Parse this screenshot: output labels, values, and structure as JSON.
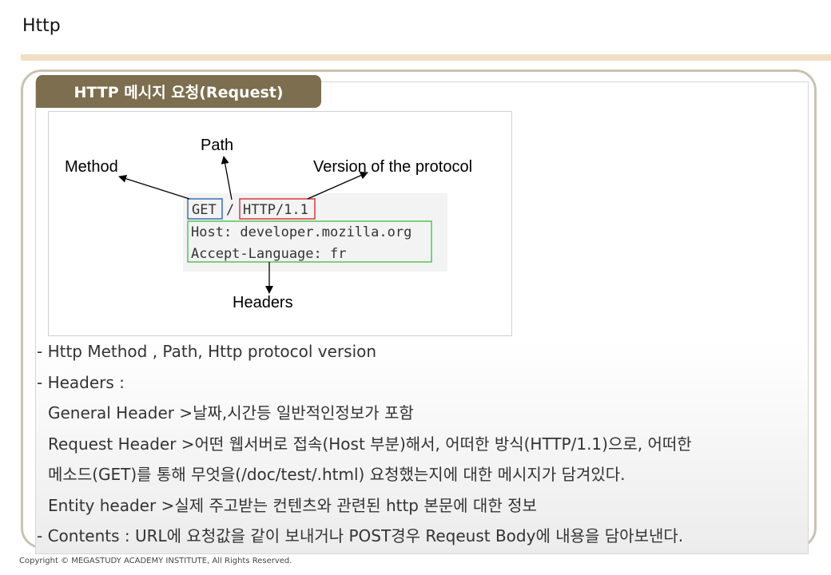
{
  "page": {
    "title": "Http"
  },
  "section": {
    "tab_label": "HTTP 메시지 요청(Request)"
  },
  "diagram": {
    "labels": {
      "method": "Method",
      "path": "Path",
      "version": "Version of the protocol",
      "headers": "Headers"
    },
    "request_line": {
      "method": "GET",
      "path": "/",
      "version": "HTTP/1.1"
    },
    "header_lines": [
      "Host: developer.mozilla.org",
      "Accept-Language: fr"
    ],
    "colors": {
      "method_box": "#3b6fb6",
      "version_box": "#d9383a",
      "headers_box": "#56c356",
      "code_bg": "#f3f3f3"
    }
  },
  "content": {
    "lines": [
      "- Http Method , Path, Http protocol version",
      "- Headers :",
      "General Header >날짜,시간등 일반적인정보가 포함",
      "Request Header >어떤 웹서버로 접속(Host 부분)해서, 어떠한 방식(HTTP/1.1)으로, 어떠한",
      "메소드(GET)를 통해 무엇을(/doc/test/.html) 요청했는지에 대한 메시지가 담겨있다.",
      "Entity header >실제 주고받는 컨텐츠와 관련된 http 본문에 대한 정보",
      "- Contents : URL에 요청값을 같이 보내거나 POST경우 Reqeust Body에 내용을 담아보낸다."
    ]
  },
  "footer": {
    "copyright": "Copyright © MEGASTUDY ACADEMY INSTITUTE, All Rights Reserved."
  }
}
